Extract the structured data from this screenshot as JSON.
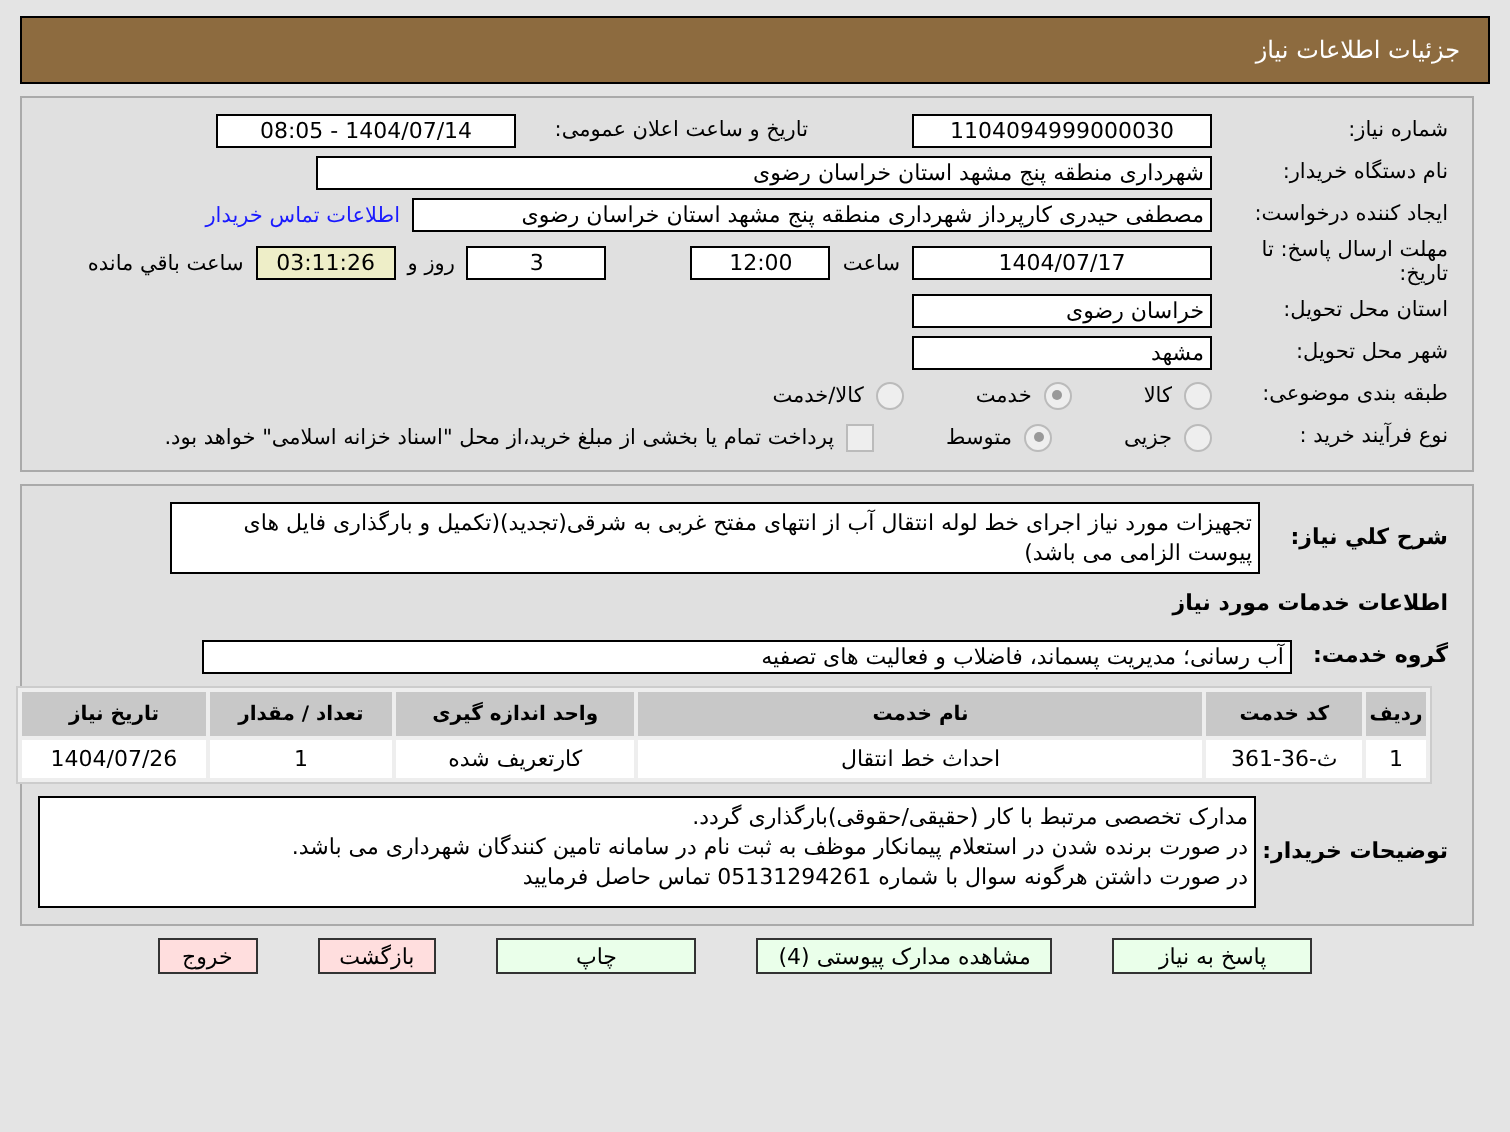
{
  "header": {
    "title": "جزئیات اطلاعات نیاز"
  },
  "need_number": {
    "label": "شماره نیاز:",
    "value": "1104094999000030"
  },
  "announce": {
    "label": "تاریخ و ساعت اعلان عمومی:",
    "value": "1404/07/14 - 08:05"
  },
  "buyer": {
    "label": "نام دستگاه خریدار:",
    "value": "شهرداری منطقه پنج مشهد استان خراسان رضوی"
  },
  "creator": {
    "label": "ایجاد کننده درخواست:",
    "value": "مصطفی حیدری کارپرداز شهرداری منطقه پنج مشهد استان خراسان رضوی",
    "link": "اطلاعات تماس خریدار"
  },
  "deadline": {
    "label": "مهلت ارسال پاسخ: تا تاریخ:",
    "date": "1404/07/17",
    "time_label": "ساعت",
    "time": "12:00",
    "days": "3",
    "days_label": "روز و",
    "remaining": "03:11:26",
    "remaining_label": "ساعت باقي مانده"
  },
  "province": {
    "label": "استان محل تحویل:",
    "value": "خراسان رضوی"
  },
  "city": {
    "label": "شهر محل تحویل:",
    "value": "مشهد"
  },
  "category": {
    "label": "طبقه بندی موضوعی:",
    "options": [
      {
        "label": "کالا",
        "selected": false
      },
      {
        "label": "خدمت",
        "selected": true
      },
      {
        "label": "کالا/خدمت",
        "selected": false
      }
    ]
  },
  "process": {
    "label": "نوع فرآیند خرید :",
    "options": [
      {
        "label": "جزیی",
        "selected": false
      },
      {
        "label": "متوسط",
        "selected": true
      }
    ],
    "payment": {
      "checked": false,
      "text": "پرداخت تمام یا بخشی از مبلغ خرید،از محل \"اسناد خزانه اسلامی\" خواهد بود."
    }
  },
  "description": {
    "label": "شرح کلي نیاز:",
    "value": "تجهیزات مورد نیاز اجرای خط لوله انتقال آب از انتهای مفتح غربی به شرقی(تجدید)(تکمیل و بارگذاری فایل های پیوست الزامی می باشد)"
  },
  "services_title": "اطلاعات خدمات مورد نیاز",
  "service_group": {
    "label": "گروه خدمت:",
    "value": "آب رسانی؛ مدیریت پسماند، فاضلاب و فعالیت های تصفیه"
  },
  "table": {
    "columns": [
      "ردیف",
      "کد خدمت",
      "نام خدمت",
      "واحد اندازه گیری",
      "تعداد / مقدار",
      "تاریخ نیاز"
    ],
    "rows": [
      [
        "1",
        "ث-36-361",
        "احداث خط انتقال",
        "کارتعریف شده",
        "1",
        "1404/07/26"
      ]
    ]
  },
  "notes": {
    "label": "توضیحات خریدار:",
    "lines": [
      "مدارک تخصصی مرتبط با کار (حقیقی/حقوقی)بارگذاری گردد.",
      "در صورت برنده شدن در استعلام پیمانکار موظف به ثبت نام در سامانه تامین کنندگان شهرداری می باشد.",
      "در صورت داشتن هرگونه سوال  با شماره 05131294261 تماس حاصل فرمایید"
    ]
  },
  "buttons": [
    {
      "label": "پاسخ به نیاز",
      "kind": "normal"
    },
    {
      "label": "مشاهده مدارک پیوستی (4)",
      "kind": "normal"
    },
    {
      "label": "چاپ",
      "kind": "normal"
    },
    {
      "label": "بازگشت",
      "kind": "exit"
    },
    {
      "label": "خروج",
      "kind": "exit"
    }
  ]
}
